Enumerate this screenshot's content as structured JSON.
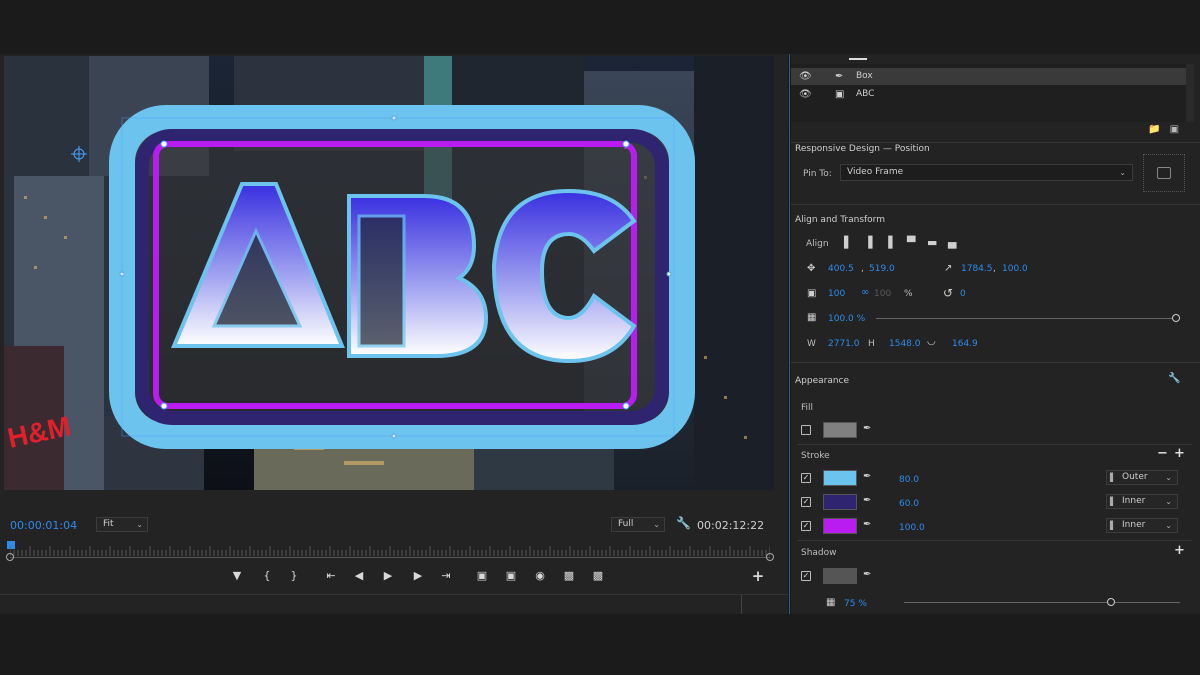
{
  "monitor": {
    "current_timecode": "00:00:01:04",
    "duration_timecode": "00:02:12:22",
    "zoom": "Fit",
    "resolution": "Full",
    "graphic_text": "ABC"
  },
  "layers": [
    {
      "name": "Box",
      "type": "pen",
      "selected": true
    },
    {
      "name": "ABC",
      "type": "text",
      "selected": false
    }
  ],
  "responsive_design": {
    "title": "Responsive Design — Position",
    "pin_to_label": "Pin To:",
    "pin_to_value": "Video Frame"
  },
  "align_transform": {
    "title": "Align and Transform",
    "align_label": "Align",
    "position_x": "400.5",
    "position_y": "519.0",
    "anchor_x": "1784.5",
    "anchor_y": "100.0",
    "scale": "100",
    "scale_height": "100",
    "scale_unit": "%",
    "rotation": "0",
    "opacity": "100.0 %",
    "opacity_fraction": 1.0,
    "w_label": "W",
    "width": "2771.0",
    "h_label": "H",
    "height": "1548.0",
    "corner_radius": "164.9"
  },
  "appearance": {
    "title": "Appearance",
    "fill": {
      "label": "Fill",
      "checked": false,
      "color": "#808080"
    },
    "stroke": {
      "label": "Stroke",
      "items": [
        {
          "checked": true,
          "color": "#6cc4ee",
          "width": "80.0",
          "type": "Outer"
        },
        {
          "checked": true,
          "color": "#2e2470",
          "width": "60.0",
          "type": "Inner"
        },
        {
          "checked": true,
          "color": "#b81cf0",
          "width": "100.0",
          "type": "Inner"
        }
      ]
    },
    "shadow": {
      "label": "Shadow",
      "checked": true,
      "color": "#555555",
      "opacity": "75 %",
      "opacity_fraction": 0.75
    }
  },
  "icons": {
    "eye": "eye-icon",
    "pen": "pen-icon",
    "text": "text-layer-icon",
    "wrench": "wrench-icon",
    "eyedropper": "eyedropper-icon"
  }
}
